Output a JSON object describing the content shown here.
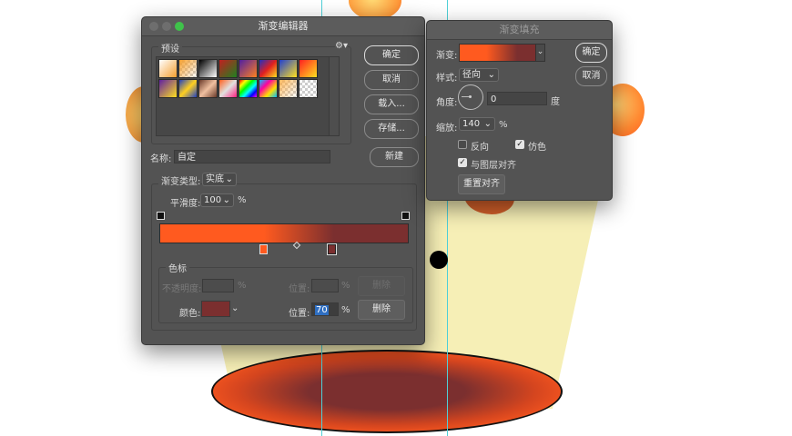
{
  "colors": {
    "accent_start": "#ff5a1f",
    "accent_end": "#7b2f2f",
    "dialog_bg": "#535353"
  },
  "gradient_editor": {
    "title": "渐变编辑器",
    "presets_label": "预设",
    "gear_icon": "gear-icon",
    "buttons": {
      "ok": "确定",
      "cancel": "取消",
      "load": "载入...",
      "save": "存储..."
    },
    "name_label": "名称:",
    "name_value": "自定",
    "new_button": "新建",
    "gradient_type_label": "渐变类型:",
    "gradient_type_value": "实底",
    "smoothness_label": "平滑度:",
    "smoothness_value": "100",
    "smoothness_unit": "%",
    "stops_group_label": "色标",
    "opacity_label": "不透明度:",
    "opacity_unit": "%",
    "opacity_location_label": "位置:",
    "opacity_location_unit": "%",
    "opacity_delete": "删除",
    "color_label": "颜色:",
    "color_location_label": "位置:",
    "color_location_value": "70",
    "color_location_unit": "%",
    "color_delete": "删除"
  },
  "gradient_fill": {
    "title": "渐变填充",
    "gradient_label": "渐变:",
    "style_label": "样式:",
    "style_value": "径向",
    "angle_label": "角度:",
    "angle_value": "0",
    "angle_unit": "度",
    "scale_label": "缩放:",
    "scale_value": "140",
    "scale_unit": "%",
    "reverse_label": "反向",
    "reverse_checked": false,
    "dither_label": "仿色",
    "dither_checked": true,
    "align_label": "与图层对齐",
    "align_checked": true,
    "reset_align": "重置对齐",
    "ok": "确定",
    "cancel": "取消"
  }
}
